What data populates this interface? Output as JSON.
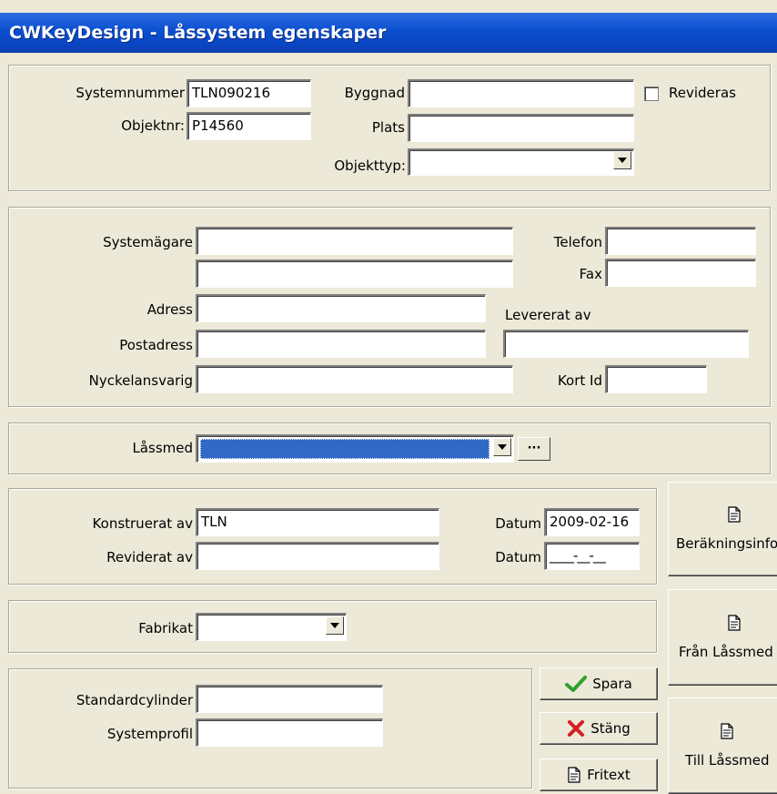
{
  "window": {
    "title": "CWKeyDesign - Låssystem egenskaper"
  },
  "section1": {
    "systemnummer_label": "Systemnummer",
    "systemnummer_value": "TLN090216",
    "objektnr_label": "Objektnr:",
    "objektnr_value": "P14560",
    "byggnad_label": "Byggnad",
    "byggnad_value": "",
    "plats_label": "Plats",
    "plats_value": "",
    "objekttyp_label": "Objekttyp:",
    "objekttyp_value": "",
    "revideras_label": "Revideras",
    "revideras_checked": false
  },
  "section2": {
    "systemagare_label": "Systemägare",
    "systemagare_value": "",
    "systemagare2_value": "",
    "telefon_label": "Telefon",
    "telefon_value": "",
    "fax_label": "Fax",
    "fax_value": "",
    "adress_label": "Adress",
    "adress_value": "",
    "levererat_label": "Levererat av",
    "levererat_value": "",
    "postadress_label": "Postadress",
    "postadress_value": "",
    "nyckelansvarig_label": "Nyckelansvarig",
    "nyckelansvarig_value": "",
    "kortid_label": "Kort Id",
    "kortid_value": ""
  },
  "section3": {
    "lassmed_label": "Låssmed",
    "lassmed_value": "",
    "browse_label": "···"
  },
  "section4": {
    "konstruerat_label": "Konstruerat av",
    "konstruerat_value": "TLN",
    "reviderat_label": "Reviderat av",
    "reviderat_value": "",
    "datum1_label": "Datum",
    "datum1_value": "2009-02-16",
    "datum2_label": "Datum",
    "datum2_value": "____-__-__"
  },
  "section5": {
    "fabrikat_label": "Fabrikat",
    "fabrikat_value": ""
  },
  "section6": {
    "standardcylinder_label": "Standardcylinder",
    "standardcylinder_value": "",
    "systemprofil_label": "Systemprofil",
    "systemprofil_value": ""
  },
  "buttons": {
    "spara": "Spara",
    "stang": "Stäng",
    "fritext": "Fritext",
    "berakningsinfo": "Beräkningsinfo",
    "fran_lassmed": "Från Låssmed",
    "till_lassmed": "Till Låssmed"
  },
  "colors": {
    "titlebar": "#0a4fd0",
    "face": "#ece9d8",
    "selection": "#316ac5",
    "check_green": "#2ea12e",
    "x_red": "#d42020"
  },
  "icons": {
    "spara": "checkmark-icon",
    "stang": "x-icon",
    "doc": "document-icon"
  }
}
